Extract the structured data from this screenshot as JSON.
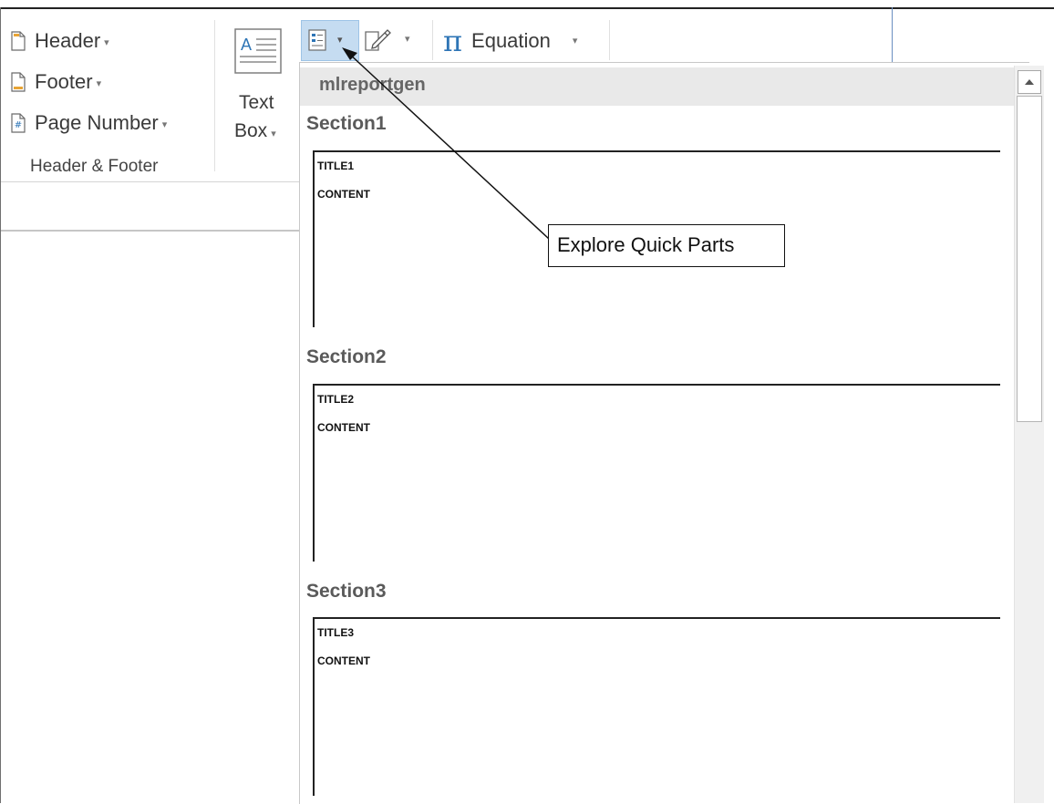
{
  "ribbon": {
    "header_label": "Header",
    "footer_label": "Footer",
    "page_number_label": "Page Number",
    "group_label": "Header & Footer",
    "text_box_line1": "Text",
    "text_box_line2": "Box",
    "equation_label": "Equation",
    "caret": "▾",
    "pi_glyph": "π"
  },
  "gallery": {
    "header": "mlreportgen",
    "sections": [
      {
        "title": "Section1",
        "part_title": "TITLE1",
        "part_content": "CONTENT"
      },
      {
        "title": "Section2",
        "part_title": "TITLE2",
        "part_content": "CONTENT"
      },
      {
        "title": "Section3",
        "part_title": "TITLE3",
        "part_content": "CONTENT"
      }
    ]
  },
  "callout": {
    "text": "Explore Quick Parts"
  },
  "colors": {
    "accent_blue": "#2e75b6",
    "selected_bg": "#c5dcf1",
    "gallery_header_bg": "#e9e9e9"
  },
  "icons": [
    "header-icon",
    "footer-icon",
    "page-number-icon",
    "text-box-icon",
    "quick-parts-icon",
    "signature-line-icon",
    "pi-icon",
    "scroll-up-arrow-icon"
  ]
}
